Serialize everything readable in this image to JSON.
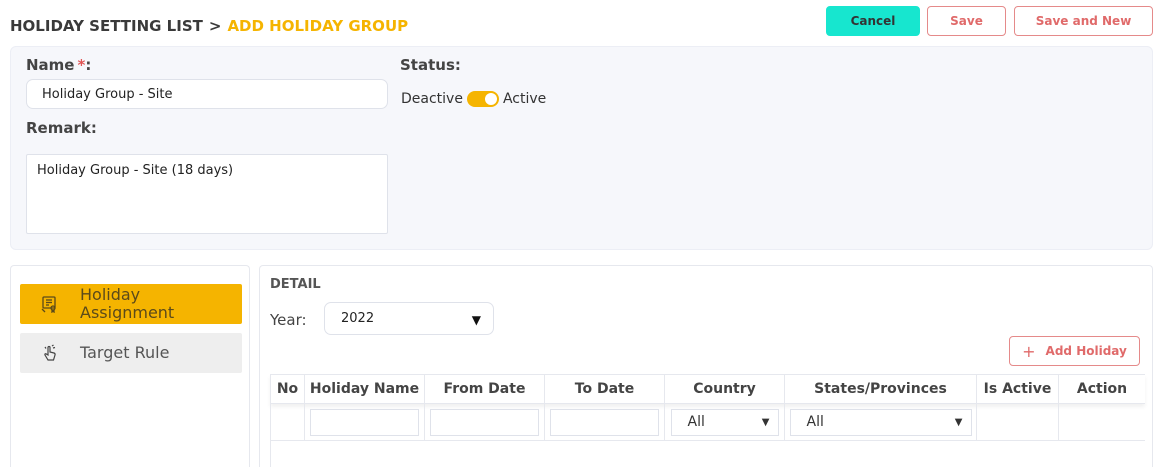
{
  "header": {
    "crumb_parent": "HOLIDAY SETTING LIST",
    "crumb_sep": ">",
    "crumb_current": "ADD HOLIDAY GROUP"
  },
  "actions": {
    "cancel_label": "Cancel",
    "save_label": "Save",
    "save_new_label": "Save and New"
  },
  "form": {
    "name_label": "Name",
    "required_mark": "*",
    "name_colon": ":",
    "name_value": "Holiday Group - Site",
    "remark_label": "Remark:",
    "remark_value": "Holiday Group - Site (18 days)",
    "status_label": "Status:",
    "status_off_label": "Deactive",
    "status_on_label": "Active",
    "status_active": true
  },
  "sidebar": {
    "items": [
      {
        "label_line1": "Holiday",
        "label_line2": "Assignment",
        "icon": "certificate-icon",
        "active": true
      },
      {
        "label": "Target Rule",
        "icon": "hand-pointer-icon",
        "active": false
      }
    ]
  },
  "detail": {
    "title": "DETAIL",
    "year_label": "Year:",
    "year_value": "2022",
    "add_label": "Add Holiday",
    "columns": [
      "No",
      "Holiday Name",
      "From Date",
      "To Date",
      "Country",
      "States/Provinces",
      "Is Active",
      "Action"
    ],
    "filters": {
      "country": "All",
      "states": "All"
    }
  },
  "colors": {
    "accent": "#f5b400",
    "cancel": "#17e6cf",
    "danger": "#e06a6a"
  }
}
